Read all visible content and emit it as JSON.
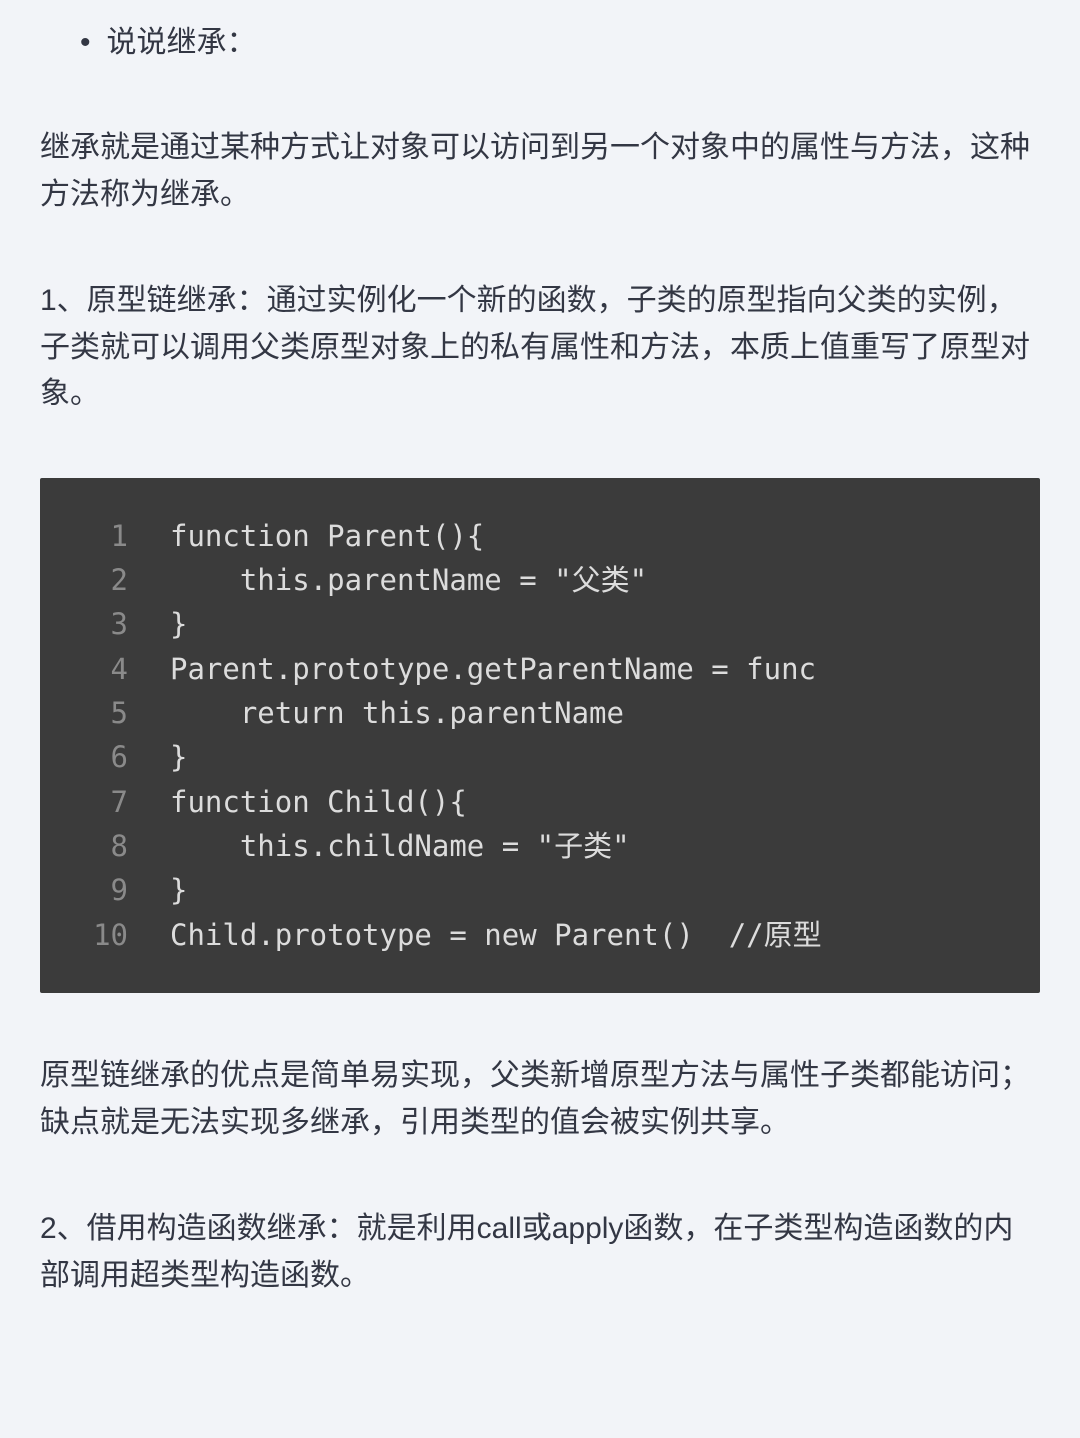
{
  "bullet": {
    "dot": "•",
    "text": "说说继承："
  },
  "paragraphs": {
    "p1": "继承就是通过某种方式让对象可以访问到另一个对象中的属性与方法，这种方法称为继承。",
    "p2": "1、原型链继承：通过实例化一个新的函数，子类的原型指向父类的实例，子类就可以调用父类原型对象上的私有属性和方法，本质上值重写了原型对象。",
    "p3": "原型链继承的优点是简单易实现，父类新增原型方法与属性子类都能访问；缺点就是无法实现多继承，引用类型的值会被实例共享。",
    "p4": "2、借用构造函数继承：就是利用call或apply函数，在子类型构造函数的内部调用超类型构造函数。"
  },
  "code": {
    "lines": [
      {
        "num": "1",
        "content": "function Parent(){"
      },
      {
        "num": "2",
        "content": "    this.parentName = \"父类\""
      },
      {
        "num": "3",
        "content": "}"
      },
      {
        "num": "4",
        "content": "Parent.prototype.getParentName = func"
      },
      {
        "num": "5",
        "content": "    return this.parentName"
      },
      {
        "num": "6",
        "content": "}"
      },
      {
        "num": "7",
        "content": "function Child(){"
      },
      {
        "num": "8",
        "content": "    this.childName = \"子类\""
      },
      {
        "num": "9",
        "content": "}"
      },
      {
        "num": "10",
        "content": "Child.prototype = new Parent()  //原型"
      }
    ]
  }
}
